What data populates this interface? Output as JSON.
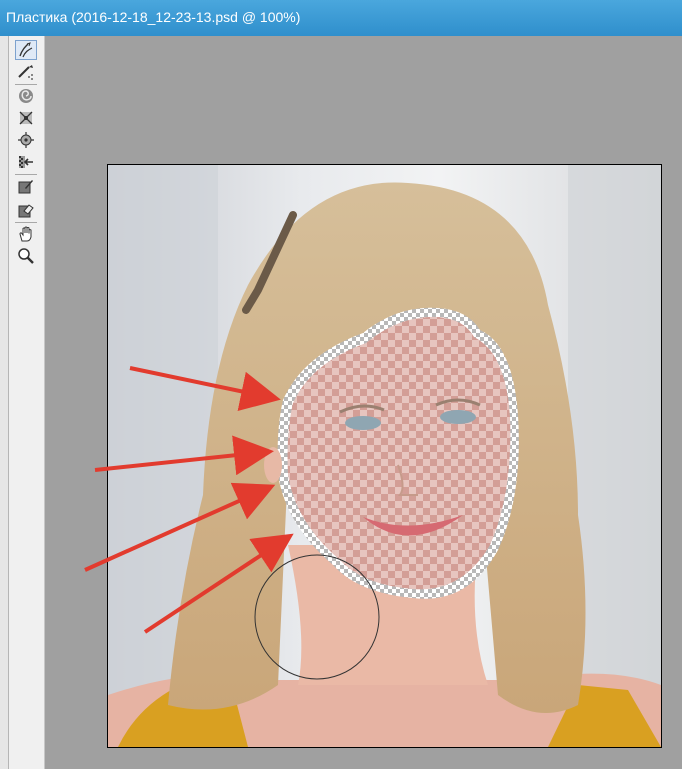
{
  "window": {
    "title": "Пластика (2016-12-18_12-23-13.psd @ 100%)"
  },
  "toolbar": {
    "tools": [
      {
        "name": "forward-warp-tool",
        "icon": "forward-warp-icon",
        "active": true
      },
      {
        "name": "reconstruct-tool",
        "icon": "reconstruct-icon",
        "active": false
      },
      {
        "name": "twirl-tool",
        "icon": "twirl-icon",
        "active": false
      },
      {
        "name": "pucker-tool",
        "icon": "pucker-icon",
        "active": false
      },
      {
        "name": "bloat-tool",
        "icon": "bloat-icon",
        "active": false
      },
      {
        "name": "push-left-tool",
        "icon": "push-left-icon",
        "active": false
      },
      {
        "name": "freeze-mask-tool",
        "icon": "freeze-mask-icon",
        "active": false
      },
      {
        "name": "thaw-mask-tool",
        "icon": "thaw-mask-icon",
        "active": false
      },
      {
        "name": "hand-tool",
        "icon": "hand-icon",
        "active": false
      },
      {
        "name": "zoom-tool",
        "icon": "zoom-icon",
        "active": false
      }
    ]
  },
  "colors": {
    "title_bar": "#2f8fcc",
    "arrow": "#e23b2e",
    "mask": "#d9a7a0"
  }
}
